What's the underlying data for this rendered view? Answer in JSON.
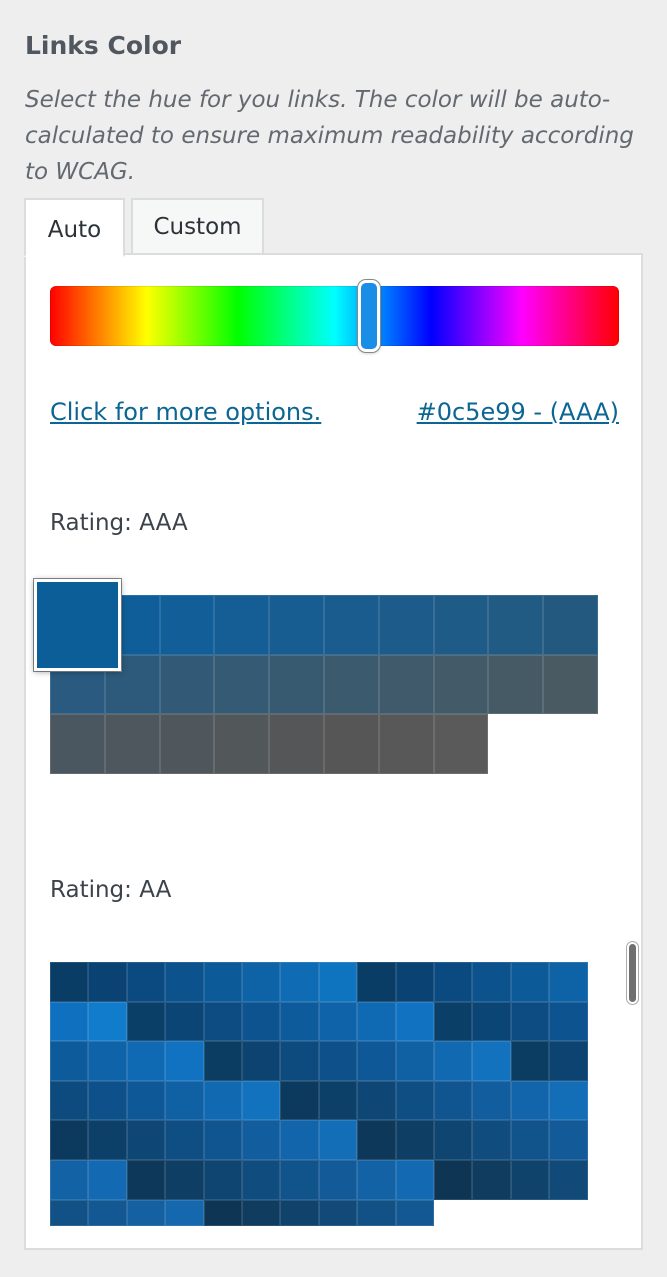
{
  "section": {
    "title": "Links Color",
    "description": "Select the hue for you links. The color will be auto-calculated to ensure maximum readability according to WCAG."
  },
  "tabs": [
    {
      "label": "Auto",
      "active": true
    },
    {
      "label": "Custom",
      "active": false
    }
  ],
  "hue_slider": {
    "position_fraction": 0.56,
    "handle_color": "#1a8ee6"
  },
  "links": {
    "more_options": "Click for more options.",
    "selected_color": "#0c5e99 - (AAA)"
  },
  "selected_color_hex": "#0c5e99",
  "ratings": [
    {
      "label": "Rating: AAA",
      "swatches": [
        "#0c5e99",
        "#0f5e9a",
        "#115e98",
        "#145d95",
        "#175d91",
        "#1a5c8e",
        "#1c5b8a",
        "#1f5b87",
        "#215a83",
        "#24597f",
        "#2a5a80",
        "#2d5a7b",
        "#325a77",
        "#355a74",
        "#385a71",
        "#3c5a6e",
        "#405a6b",
        "#435a68",
        "#465a66",
        "#495a63",
        "#4b5760",
        "#4e575e",
        "#50575c",
        "#52575a",
        "#545657",
        "#565656",
        "#585858",
        "#5a5a5a"
      ]
    },
    {
      "label": "Rating: AA",
      "swatches": [
        "#093d66",
        "#0a4373",
        "#0b4a80",
        "#0c528c",
        "#0d5a99",
        "#0e62a6",
        "#0f6bb3",
        "#0f74c0",
        "#093d66",
        "#0a4373",
        "#0b4a80",
        "#0c528c",
        "#0d5a99",
        "#0e62a6",
        "#1070c0",
        "#117bcc",
        "#0a3f68",
        "#0b4575",
        "#0c4c82",
        "#0d538f",
        "#0e5b9c",
        "#0f63a9",
        "#1069b3",
        "#1172c2",
        "#0a3f68",
        "#0b4575",
        "#0c4c82",
        "#0d538f",
        "#0e5b9c",
        "#0f63a9",
        "#1069b3",
        "#1172c2",
        "#0b3d63",
        "#0c4370",
        "#0d4a7d",
        "#0e518a",
        "#0f5897",
        "#1060a4",
        "#1169b1",
        "#1272be",
        "#0b3d63",
        "#0c4370",
        "#0d4a7d",
        "#0e518a",
        "#0f5897",
        "#1060a4",
        "#1169b1",
        "#1272be",
        "#0c3a5e",
        "#0d4069",
        "#0e4776",
        "#0f4e83",
        "#105590",
        "#115d9d",
        "#1265aa",
        "#136eb7",
        "#0c3a5e",
        "#0d4069",
        "#0e4776",
        "#0f4e83",
        "#105590",
        "#115d9d",
        "#1265aa",
        "#136eb7",
        "#0d3859",
        "#0e3e64",
        "#0f4571",
        "#104c7e",
        "#11538b",
        "#125a98",
        "#1362a5",
        "#146ab2",
        "#0d3859",
        "#0e3e64",
        "#0f4571",
        "#104c7e",
        "#11538b",
        "#125a98",
        "#1362a5",
        "#146ab2",
        "#0e3654",
        "#0f3c5f",
        "#10436c",
        "#114a79",
        "#125186",
        "#135893",
        "#1460a0",
        "#1568ad",
        "#0e3654",
        "#0f3c5f",
        "#10436c",
        "#114a79",
        "#125186",
        "#135893"
      ]
    }
  ]
}
